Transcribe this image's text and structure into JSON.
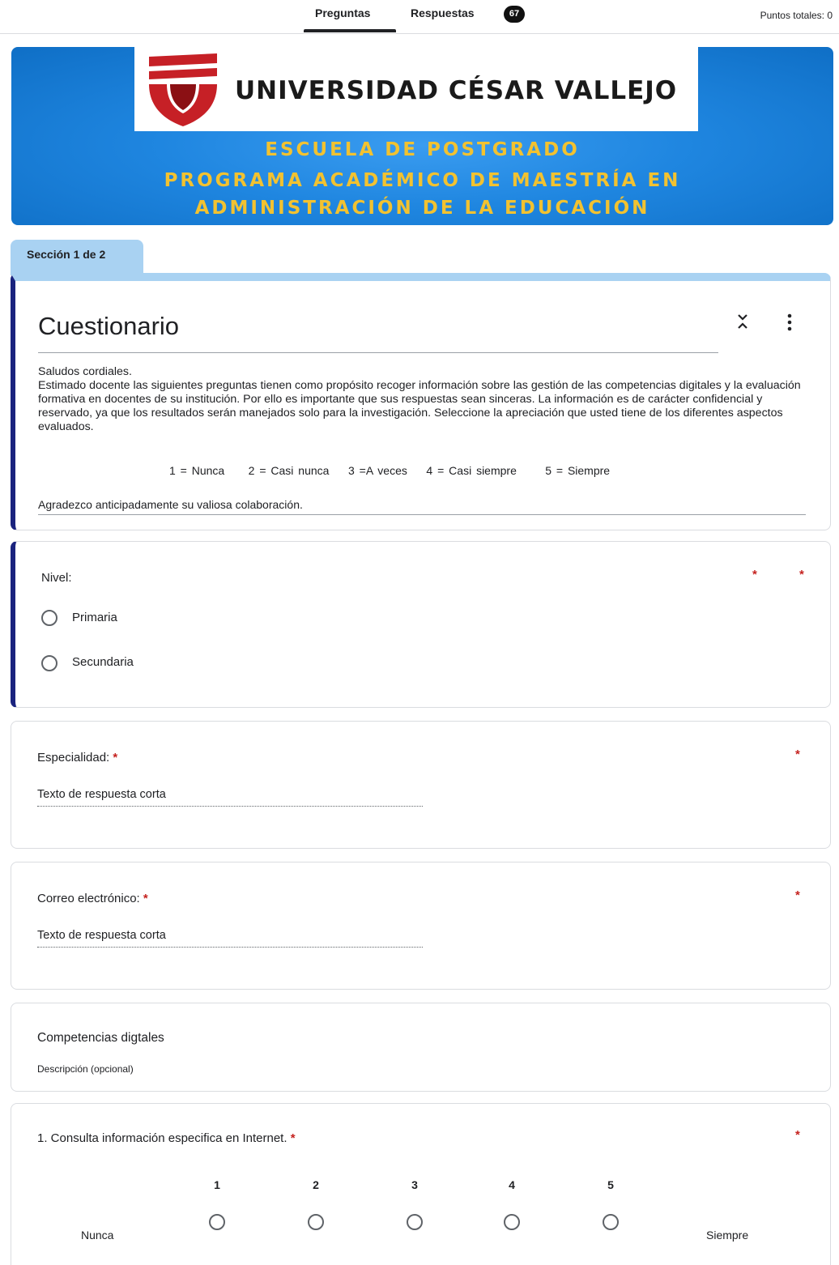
{
  "topbar": {
    "tabs": [
      "Preguntas",
      "Respuestas"
    ],
    "responses_count": "67",
    "total_points": "Puntos totales: 0"
  },
  "header": {
    "university": "UNIVERSIDAD CÉSAR VALLEJO",
    "line1": "ESCUELA DE POSTGRADO",
    "line2": "PROGRAMA ACADÉMICO DE MAESTRÍA EN",
    "line3": "ADMINISTRACIÓN DE LA EDUCACIÓN",
    "colors": {
      "banner": "#1f86e0",
      "title_text": "#f2c230",
      "logo_red": "#c62026"
    }
  },
  "section": {
    "label": "Sección 1 de 2"
  },
  "intro": {
    "title": "Cuestionario",
    "greeting": "Saludos cordiales.",
    "description": "Estimado docente las siguientes preguntas tienen como propósito recoger información sobre las gestión de las competencias digitales y la evaluación formativa en docentes de su institución. Por ello es importante que sus respuestas sean sinceras. La información es de carácter  confidencial y reservado, ya que los resultados serán manejados solo para la investigación. Seleccione la apreciación que usted tiene de los diferentes aspectos evaluados.",
    "scale": "1 = Nunca     2 = Casi nunca    3 =A veces    4 = Casi siempre      5 = Siempre",
    "thanks": "Agradezco anticipadamente su valiosa colaboración."
  },
  "questions": {
    "nivel": {
      "title": "Nivel:",
      "options": [
        "Primaria",
        "Secundaria"
      ]
    },
    "especialidad": {
      "title": "Especialidad:",
      "placeholder": "Texto de respuesta corta"
    },
    "correo": {
      "title": "Correo electrónico:",
      "placeholder": "Texto de respuesta corta"
    },
    "competencias": {
      "title": "Competencias digtales",
      "description": "Descripción (opcional)"
    },
    "q1": {
      "title": "1. Consulta información especifica en Internet.",
      "scale_numbers": [
        "1",
        "2",
        "3",
        "4",
        "5"
      ],
      "low_label": "Nunca",
      "high_label": "Siempre"
    }
  },
  "required_marker": "*",
  "icons": [
    "collapse-icon",
    "more-vert-icon",
    "radio-unchecked-icon"
  ]
}
